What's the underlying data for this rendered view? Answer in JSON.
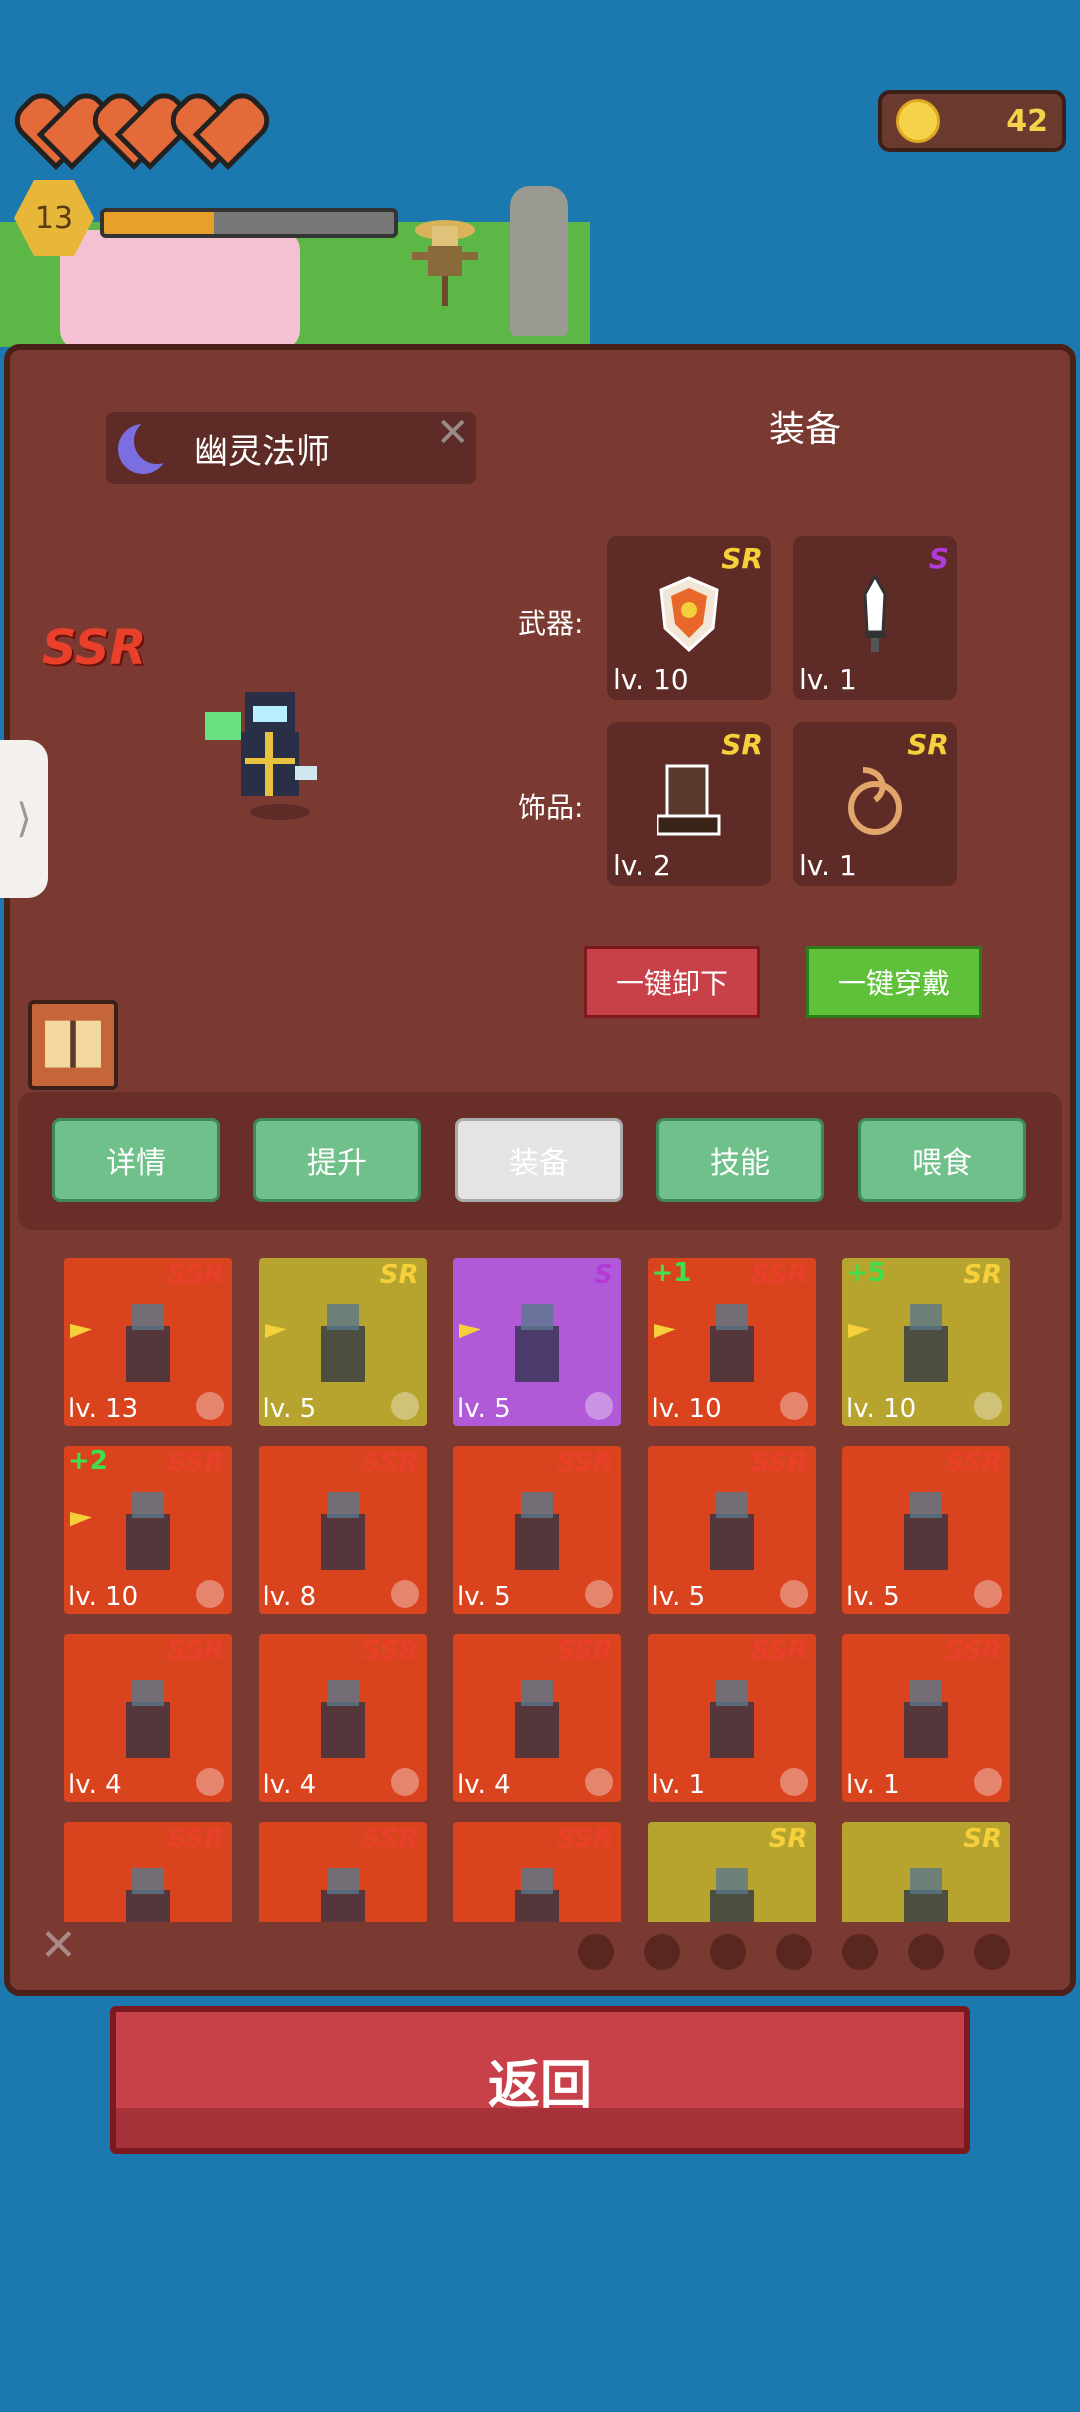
{
  "hud": {
    "hearts": 3,
    "coins": "42",
    "level": "13",
    "xp_fraction": 0.38
  },
  "hero": {
    "name": "幽灵法师",
    "rarity": "SSR",
    "close_label": "✕"
  },
  "equipment": {
    "title": "装备",
    "weapon_label": "武器:",
    "accessory_label": "饰品:",
    "slots": [
      {
        "rarity": "SR",
        "level": "lv. 10",
        "item": "shield-icon"
      },
      {
        "rarity": "S",
        "level": "lv. 1",
        "item": "dagger-icon"
      },
      {
        "rarity": "SR",
        "level": "lv. 2",
        "item": "boots-icon"
      },
      {
        "rarity": "SR",
        "level": "lv. 1",
        "item": "rope-icon"
      }
    ],
    "unequip_all": "一键卸下",
    "equip_all": "一键穿戴"
  },
  "tabs": [
    "详情",
    "提升",
    "装备",
    "技能",
    "喂食"
  ],
  "active_tab": 2,
  "cards": [
    {
      "rarity": "SSR",
      "level": "lv. 13",
      "bonus": "",
      "bg": "#d9441f",
      "flag": true
    },
    {
      "rarity": "SR",
      "level": "lv. 5",
      "bonus": "",
      "bg": "#b7a42e",
      "flag": true
    },
    {
      "rarity": "S",
      "level": "lv. 5",
      "bonus": "",
      "bg": "#b15ad8",
      "flag": true
    },
    {
      "rarity": "SSR",
      "level": "lv. 10",
      "bonus": "+1",
      "bg": "#d9441f",
      "flag": true
    },
    {
      "rarity": "SR",
      "level": "lv. 10",
      "bonus": "+5",
      "bg": "#b7a42e",
      "flag": true
    },
    {
      "rarity": "SSR",
      "level": "lv. 10",
      "bonus": "+2",
      "bg": "#d9441f",
      "flag": true
    },
    {
      "rarity": "SSR",
      "level": "lv. 8",
      "bonus": "",
      "bg": "#d9441f",
      "flag": false
    },
    {
      "rarity": "SSR",
      "level": "lv. 5",
      "bonus": "",
      "bg": "#d9441f",
      "flag": false
    },
    {
      "rarity": "SSR",
      "level": "lv. 5",
      "bonus": "",
      "bg": "#d9441f",
      "flag": false
    },
    {
      "rarity": "SSR",
      "level": "lv. 5",
      "bonus": "",
      "bg": "#d9441f",
      "flag": false
    },
    {
      "rarity": "SSR",
      "level": "lv. 4",
      "bonus": "",
      "bg": "#d9441f",
      "flag": false
    },
    {
      "rarity": "SSR",
      "level": "lv. 4",
      "bonus": "",
      "bg": "#d9441f",
      "flag": false
    },
    {
      "rarity": "SSR",
      "level": "lv. 4",
      "bonus": "",
      "bg": "#d9441f",
      "flag": false
    },
    {
      "rarity": "SSR",
      "level": "lv. 1",
      "bonus": "",
      "bg": "#d9441f",
      "flag": false
    },
    {
      "rarity": "SSR",
      "level": "lv. 1",
      "bonus": "",
      "bg": "#d9441f",
      "flag": false
    },
    {
      "rarity": "SSR",
      "level": "",
      "bonus": "",
      "bg": "#d9441f",
      "flag": false
    },
    {
      "rarity": "SSR",
      "level": "",
      "bonus": "",
      "bg": "#d9441f",
      "flag": false
    },
    {
      "rarity": "SSR",
      "level": "",
      "bonus": "",
      "bg": "#d9441f",
      "flag": false
    },
    {
      "rarity": "SR",
      "level": "",
      "bonus": "",
      "bg": "#b7a42e",
      "flag": false
    },
    {
      "rarity": "SR",
      "level": "",
      "bonus": "",
      "bg": "#b7a42e",
      "flag": false
    }
  ],
  "colors": {
    "ssr": "#e8402a",
    "sr": "#f6d03a",
    "s": "#b13ad8"
  },
  "return_label": "返回"
}
